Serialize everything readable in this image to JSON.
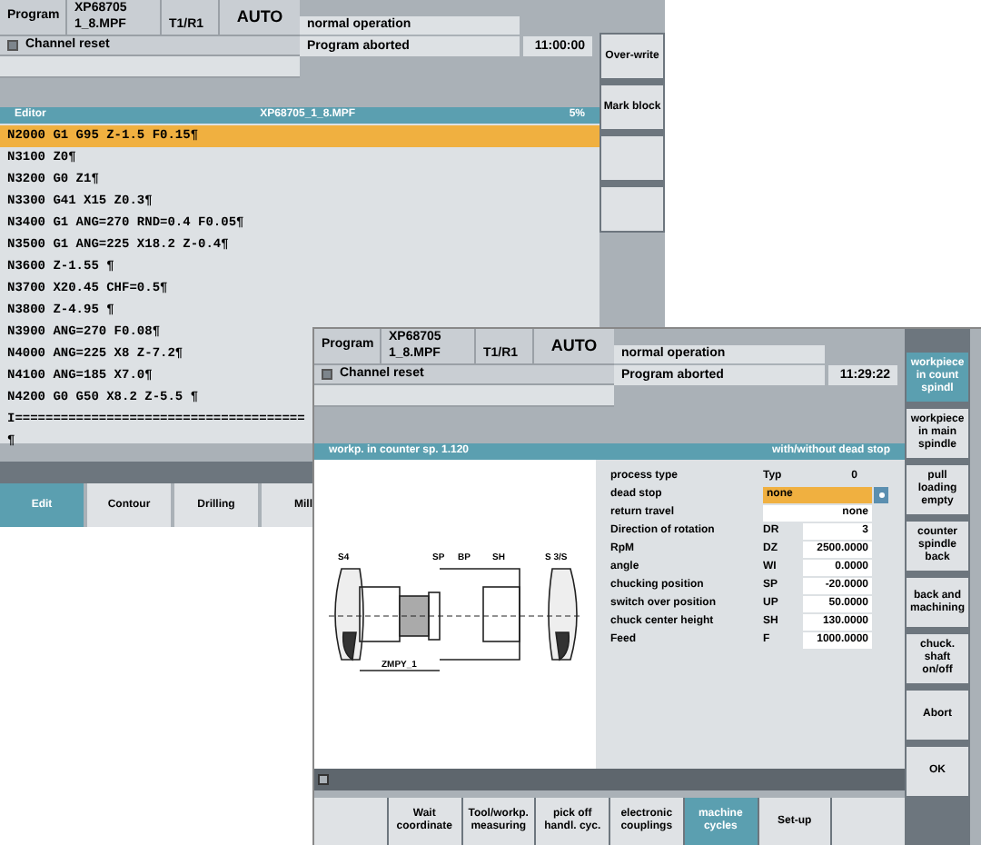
{
  "back_window": {
    "header": {
      "program_label": "Program",
      "program_name": "XP68705",
      "program_file": "1_8.MPF",
      "tool": "T1/R1",
      "mode": "AUTO",
      "operation": "normal operation",
      "channel_status": "Channel reset",
      "program_status": "Program aborted",
      "time": "11:00:00"
    },
    "editor": {
      "title": "Editor",
      "file": "XP68705_1_8.MPF",
      "percent": "5%",
      "lines": [
        {
          "text": "N2000 G1 G95 Z-1.5 F0.15¶",
          "selected": true
        },
        {
          "text": "N3100 Z0¶",
          "selected": false
        },
        {
          "text": "N3200 G0 Z1¶",
          "selected": false
        },
        {
          "text": "N3300 G41 X15 Z0.3¶",
          "selected": false
        },
        {
          "text": "N3400 G1 ANG=270 RND=0.4 F0.05¶",
          "selected": false
        },
        {
          "text": "N3500 G1 ANG=225 X18.2 Z-0.4¶",
          "selected": false
        },
        {
          "text": "N3600 Z-1.55 ¶",
          "selected": false
        },
        {
          "text": "N3700 X20.45 CHF=0.5¶",
          "selected": false
        },
        {
          "text": "N3800 Z-4.95 ¶",
          "selected": false
        },
        {
          "text": "N3900 ANG=270 F0.08¶",
          "selected": false
        },
        {
          "text": "N4000 ANG=225 X8 Z-7.2¶",
          "selected": false
        },
        {
          "text": "N4100 ANG=185 X7.0¶",
          "selected": false
        },
        {
          "text": "N4200 G0 G50 X8.2 Z-5.5 ¶",
          "selected": false
        },
        {
          "text": "I======================================",
          "selected": false
        },
        {
          "text": "¶",
          "selected": false
        }
      ]
    },
    "tabs": [
      {
        "label": "Edit",
        "selected": true
      },
      {
        "label": "Contour",
        "selected": false
      },
      {
        "label": "Drilling",
        "selected": false
      },
      {
        "label": "Mill",
        "selected": false
      }
    ],
    "softkeys": [
      {
        "kind": "key",
        "label": "Over-write"
      },
      {
        "kind": "key",
        "label": "Mark block"
      },
      {
        "kind": "blank"
      },
      {
        "kind": "blank"
      }
    ]
  },
  "front_window": {
    "header": {
      "program_label": "Program",
      "program_name": "XP68705",
      "program_file": "1_8.MPF",
      "tool": "T1/R1",
      "mode": "AUTO",
      "operation": "normal operation",
      "channel_status": "Channel reset",
      "program_status": "Program aborted",
      "time": "11:29:22"
    },
    "dialog": {
      "title": "workp. in counter sp. 1.120",
      "subtitle": "with/without dead stop",
      "diagram_labels": [
        "S4",
        "SP",
        "BP",
        "SH",
        "S 3/S",
        "ZMPY_1"
      ],
      "params": [
        {
          "kind": "text",
          "label": "process type",
          "symbol": "Typ",
          "value": "0"
        },
        {
          "kind": "select",
          "label": "dead stop",
          "value": "none"
        },
        {
          "kind": "choice",
          "label": "return travel",
          "value": "none"
        },
        {
          "kind": "input",
          "label": "Direction of rotation",
          "symbol": "DR",
          "value": "3"
        },
        {
          "kind": "input",
          "label": "RpM",
          "symbol": "DZ",
          "value": "2500.0000"
        },
        {
          "kind": "input",
          "label": "angle",
          "symbol": "WI",
          "value": "0.0000"
        },
        {
          "kind": "input",
          "label": "chucking position",
          "symbol": "SP",
          "value": "-20.0000"
        },
        {
          "kind": "input",
          "label": "switch over position",
          "symbol": "UP",
          "value": "50.0000"
        },
        {
          "kind": "input",
          "label": "chuck center height",
          "symbol": "SH",
          "value": "130.0000"
        },
        {
          "kind": "input",
          "label": "Feed",
          "symbol": "F",
          "value": "1000.0000"
        }
      ]
    },
    "softkeys": [
      {
        "kind": "key",
        "label": "workpiece in count spindl",
        "selected": true
      },
      {
        "kind": "key",
        "label": "workpiece in main spindle",
        "selected": false
      },
      {
        "kind": "key",
        "label": "pull loading empty",
        "selected": false
      },
      {
        "kind": "key",
        "label": "counter spindle back",
        "selected": false
      },
      {
        "kind": "key",
        "label": "back and machining",
        "selected": false
      },
      {
        "kind": "key",
        "label": "chuck. shaft on/off",
        "selected": false
      },
      {
        "kind": "key",
        "label": "Abort",
        "selected": false
      },
      {
        "kind": "key",
        "label": "OK",
        "selected": false
      }
    ],
    "bottom_softkeys": [
      {
        "kind": "blank"
      },
      {
        "kind": "key",
        "label": "Wait coordinate",
        "selected": false
      },
      {
        "kind": "key",
        "label": "Tool/workp. measuring",
        "selected": false
      },
      {
        "kind": "key",
        "label": "pick off handl. cyc.",
        "selected": false
      },
      {
        "kind": "key",
        "label": "electronic couplings",
        "selected": false
      },
      {
        "kind": "key",
        "label": "machine cycles",
        "selected": true
      },
      {
        "kind": "key",
        "label": "Set-up",
        "selected": false
      },
      {
        "kind": "blank"
      }
    ]
  }
}
